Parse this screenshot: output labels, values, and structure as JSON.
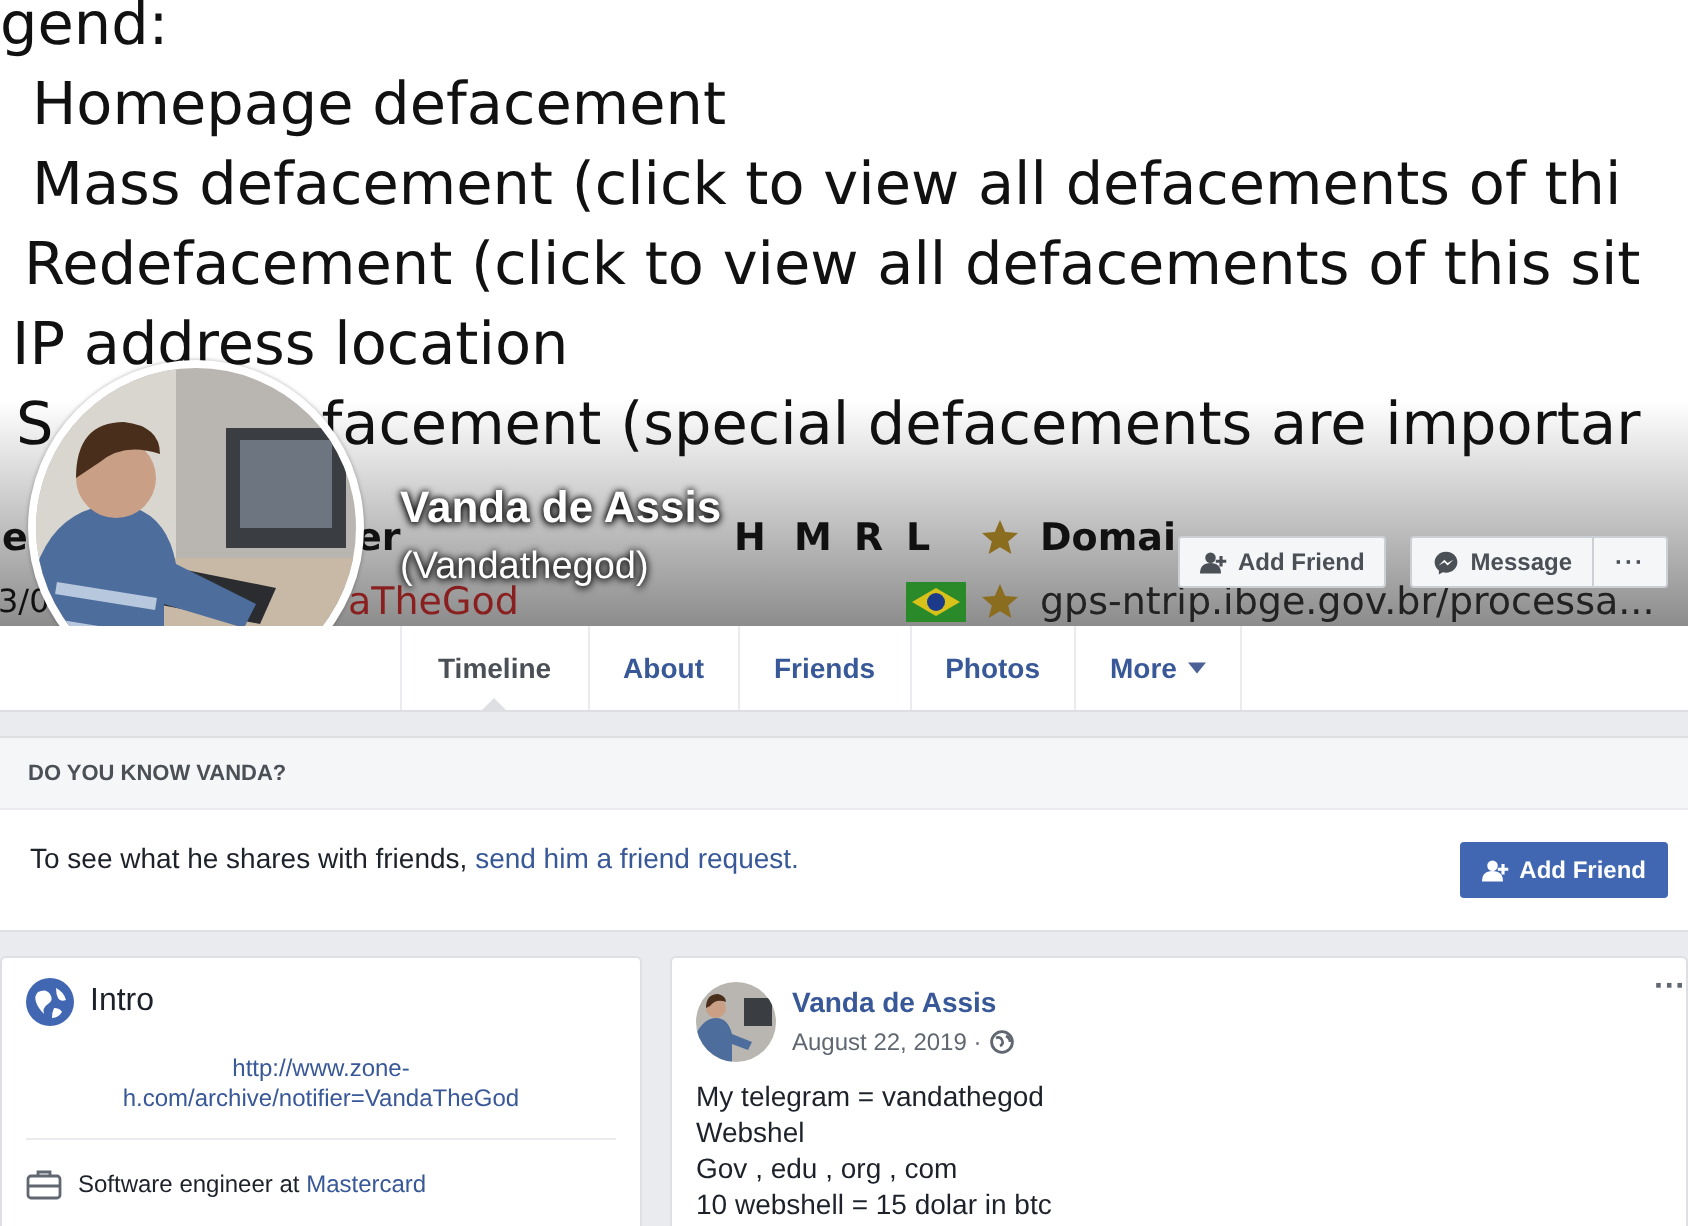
{
  "cover": {
    "lines": [
      "gend:",
      "Homepage defacement",
      "Mass defacement (click to view all defacements of thi",
      "Redefacement (click to view all defacements of this sit",
      "IP address location"
    ],
    "last_start": "S",
    "last_rest": "facement (special defacements are importar",
    "header": [
      "e",
      "er",
      "H",
      "M",
      "R",
      "L",
      "Domai"
    ],
    "row": {
      "date": "3/0",
      "notifier": "aTheGod",
      "domain": "gps-ntrip.ibge.gov.br/processa..."
    }
  },
  "profile": {
    "name": "Vanda de Assis",
    "alias": "(Vandathegod)"
  },
  "actions": [
    {
      "label": "Add Friend",
      "kind": "add"
    },
    {
      "label": "Message",
      "kind": "message"
    },
    {
      "label": "···",
      "kind": "more"
    }
  ],
  "tabs": [
    {
      "label": "Timeline",
      "selected": true,
      "caret": false
    },
    {
      "label": "About",
      "selected": false,
      "caret": false
    },
    {
      "label": "Friends",
      "selected": false,
      "caret": false
    },
    {
      "label": "Photos",
      "selected": false,
      "caret": false
    },
    {
      "label": "More",
      "selected": false,
      "caret": true
    }
  ],
  "know": {
    "title": "DO YOU KNOW VANDA?",
    "text": "To see what he shares with friends, ",
    "link": "send him a friend request.",
    "button": "Add Friend"
  },
  "intro": {
    "title": "Intro",
    "link": "http://www.zone-h.com/archive/notifier=VandaTheGod",
    "work": "Software engineer at ",
    "work_link": "Mastercard"
  },
  "post": {
    "author": "Vanda de Assis",
    "date": "August 22, 2019 ·",
    "menu": "···",
    "lines": [
      "My telegram = vandathegod",
      "Webshel",
      "Gov , edu , org , com",
      "10 webshell = 15 dolar in btc"
    ]
  }
}
